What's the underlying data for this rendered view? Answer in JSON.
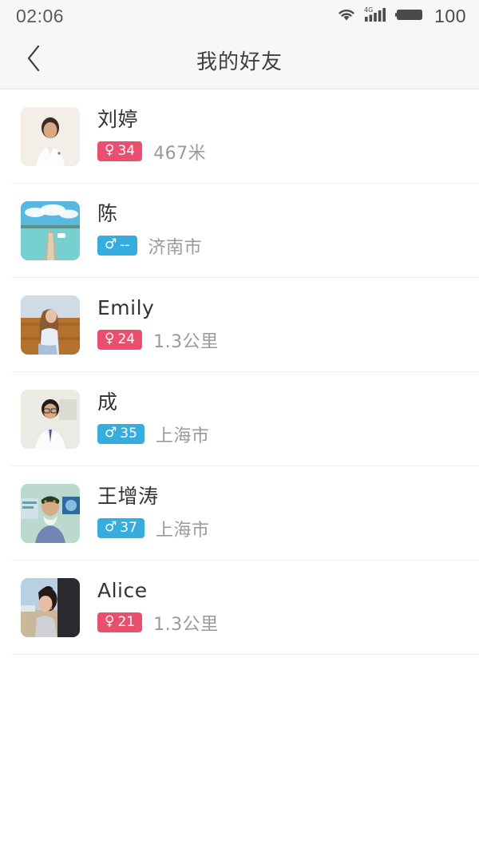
{
  "status_bar": {
    "time": "02:06",
    "battery_level": "100",
    "wifi_icon": "wifi-icon",
    "signal_icon": "signal-4g-icon",
    "battery_icon": "battery-icon",
    "network_label": "4G"
  },
  "nav": {
    "back_icon": "chevron-left-icon",
    "title": "我的好友"
  },
  "theme": {
    "female_badge_color": "#ea4f70",
    "male_badge_color": "#37addf",
    "header_background": "#f7f7f7",
    "name_color": "#333333",
    "sub_text_color": "#9a9a9a",
    "divider_color": "#ededed"
  },
  "friends": [
    {
      "name": "刘婷",
      "gender": "female",
      "gender_symbol": "♀",
      "age": "34",
      "sub": "467米",
      "avatar_name": "avatar-liu-ting"
    },
    {
      "name": "陈",
      "gender": "male",
      "gender_symbol": "♂",
      "age": "--",
      "sub": "济南市",
      "avatar_name": "avatar-chen"
    },
    {
      "name": "Emily",
      "gender": "female",
      "gender_symbol": "♀",
      "age": "24",
      "sub": "1.3公里",
      "avatar_name": "avatar-emily"
    },
    {
      "name": "成",
      "gender": "male",
      "gender_symbol": "♂",
      "age": "35",
      "sub": "上海市",
      "avatar_name": "avatar-cheng"
    },
    {
      "name": "王增涛",
      "gender": "male",
      "gender_symbol": "♂",
      "age": "37",
      "sub": "上海市",
      "avatar_name": "avatar-wang-zengtao"
    },
    {
      "name": "Alice",
      "gender": "female",
      "gender_symbol": "♀",
      "age": "21",
      "sub": "1.3公里",
      "avatar_name": "avatar-alice"
    }
  ]
}
